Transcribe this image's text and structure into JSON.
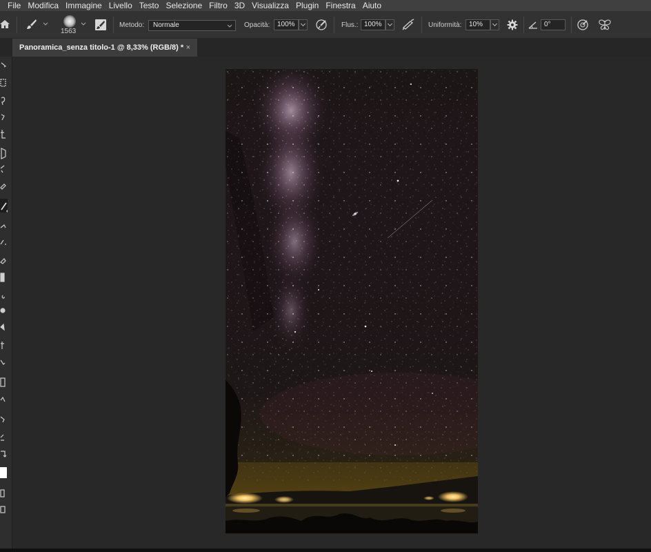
{
  "menu": [
    "File",
    "Modifica",
    "Immagine",
    "Livello",
    "Testo",
    "Selezione",
    "Filtro",
    "3D",
    "Visualizza",
    "Plugin",
    "Finestra",
    "Aiuto"
  ],
  "options": {
    "brush_size": "1563",
    "method_label": "Metodo:",
    "method_value": "Normale",
    "opacity_label": "Opacità:",
    "opacity_value": "100%",
    "flow_label": "Flus.:",
    "flow_value": "100%",
    "smoothing_label": "Uniformità:",
    "smoothing_value": "10%",
    "angle_value": "0°"
  },
  "document": {
    "tab_title": "Panoramica_senza titolo-1 @ 8,33% (RGB/8) *",
    "close_glyph": "×"
  },
  "icons": {
    "home": "home-icon",
    "brush": "brush-icon",
    "brush_panel": "brush-settings-icon",
    "pressure_opacity": "pressure-opacity-icon",
    "airbrush": "airbrush-icon",
    "gear": "gear-icon",
    "angle": "angle-icon",
    "pressure_size": "pressure-size-icon",
    "symmetry": "symmetry-butterfly-icon"
  },
  "colors": {
    "accent": "#f0c060",
    "panel": "#323232",
    "canvas": "#282828"
  }
}
